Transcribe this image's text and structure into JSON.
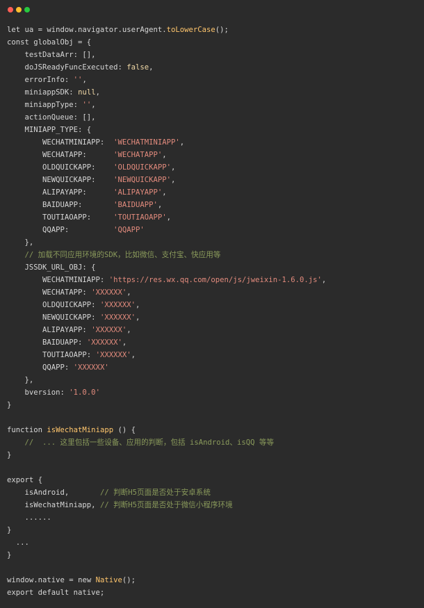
{
  "window": {
    "controls": {
      "close_color": "#ff5f56",
      "minimize_color": "#ffbd2e",
      "zoom_color": "#27c93f"
    },
    "background": "#2b2b2b"
  },
  "code": {
    "language": "javascript",
    "lines": [
      [
        {
          "t": "let ua = window.navigator.userAgent.",
          "c": "plain"
        },
        {
          "t": "toLowerCase",
          "c": "fn"
        },
        {
          "t": "();",
          "c": "plain"
        }
      ],
      [
        {
          "t": "const globalObj = {",
          "c": "plain"
        }
      ],
      [
        {
          "t": "    testDataArr: [],",
          "c": "plain"
        }
      ],
      [
        {
          "t": "    doJSReadyFuncExecuted: ",
          "c": "plain"
        },
        {
          "t": "false",
          "c": "lit"
        },
        {
          "t": ",",
          "c": "plain"
        }
      ],
      [
        {
          "t": "    errorInfo: ",
          "c": "plain"
        },
        {
          "t": "''",
          "c": "str"
        },
        {
          "t": ",",
          "c": "plain"
        }
      ],
      [
        {
          "t": "    miniappSDK: ",
          "c": "plain"
        },
        {
          "t": "null",
          "c": "lit"
        },
        {
          "t": ",",
          "c": "plain"
        }
      ],
      [
        {
          "t": "    miniappType: ",
          "c": "plain"
        },
        {
          "t": "''",
          "c": "str"
        },
        {
          "t": ",",
          "c": "plain"
        }
      ],
      [
        {
          "t": "    actionQueue: [],",
          "c": "plain"
        }
      ],
      [
        {
          "t": "    MINIAPP_TYPE: {",
          "c": "plain"
        }
      ],
      [
        {
          "t": "        WECHATMINIAPP:  ",
          "c": "plain"
        },
        {
          "t": "'WECHATMINIAPP'",
          "c": "str"
        },
        {
          "t": ",",
          "c": "plain"
        }
      ],
      [
        {
          "t": "        WECHATAPP:      ",
          "c": "plain"
        },
        {
          "t": "'WECHATAPP'",
          "c": "str"
        },
        {
          "t": ",",
          "c": "plain"
        }
      ],
      [
        {
          "t": "        OLDQUICKAPP:    ",
          "c": "plain"
        },
        {
          "t": "'OLDQUICKAPP'",
          "c": "str"
        },
        {
          "t": ",",
          "c": "plain"
        }
      ],
      [
        {
          "t": "        NEWQUICKAPP:    ",
          "c": "plain"
        },
        {
          "t": "'NEWQUICKAPP'",
          "c": "str"
        },
        {
          "t": ",",
          "c": "plain"
        }
      ],
      [
        {
          "t": "        ALIPAYAPP:      ",
          "c": "plain"
        },
        {
          "t": "'ALIPAYAPP'",
          "c": "str"
        },
        {
          "t": ",",
          "c": "plain"
        }
      ],
      [
        {
          "t": "        BAIDUAPP:       ",
          "c": "plain"
        },
        {
          "t": "'BAIDUAPP'",
          "c": "str"
        },
        {
          "t": ",",
          "c": "plain"
        }
      ],
      [
        {
          "t": "        TOUTIAOAPP:     ",
          "c": "plain"
        },
        {
          "t": "'TOUTIAOAPP'",
          "c": "str"
        },
        {
          "t": ",",
          "c": "plain"
        }
      ],
      [
        {
          "t": "        QQAPP:          ",
          "c": "plain"
        },
        {
          "t": "'QQAPP'",
          "c": "str"
        }
      ],
      [
        {
          "t": "    },",
          "c": "plain"
        }
      ],
      [
        {
          "t": "    // 加载不同应用环境的SDK，比如微信、支付宝、快应用等",
          "c": "com"
        }
      ],
      [
        {
          "t": "    JSSDK_URL_OBJ: {",
          "c": "plain"
        }
      ],
      [
        {
          "t": "        WECHATMINIAPP: ",
          "c": "plain"
        },
        {
          "t": "'https://res.wx.qq.com/open/js/jweixin-1.6.0.js'",
          "c": "str"
        },
        {
          "t": ",",
          "c": "plain"
        }
      ],
      [
        {
          "t": "        WECHATAPP: ",
          "c": "plain"
        },
        {
          "t": "'XXXXXX'",
          "c": "str"
        },
        {
          "t": ",",
          "c": "plain"
        }
      ],
      [
        {
          "t": "        OLDQUICKAPP: ",
          "c": "plain"
        },
        {
          "t": "'XXXXXX'",
          "c": "str"
        },
        {
          "t": ",",
          "c": "plain"
        }
      ],
      [
        {
          "t": "        NEWQUICKAPP: ",
          "c": "plain"
        },
        {
          "t": "'XXXXXX'",
          "c": "str"
        },
        {
          "t": ",",
          "c": "plain"
        }
      ],
      [
        {
          "t": "        ALIPAYAPP: ",
          "c": "plain"
        },
        {
          "t": "'XXXXXX'",
          "c": "str"
        },
        {
          "t": ",",
          "c": "plain"
        }
      ],
      [
        {
          "t": "        BAIDUAPP: ",
          "c": "plain"
        },
        {
          "t": "'XXXXXX'",
          "c": "str"
        },
        {
          "t": ",",
          "c": "plain"
        }
      ],
      [
        {
          "t": "        TOUTIAOAPP: ",
          "c": "plain"
        },
        {
          "t": "'XXXXXX'",
          "c": "str"
        },
        {
          "t": ",",
          "c": "plain"
        }
      ],
      [
        {
          "t": "        QQAPP: ",
          "c": "plain"
        },
        {
          "t": "'XXXXXX'",
          "c": "str"
        }
      ],
      [
        {
          "t": "    },",
          "c": "plain"
        }
      ],
      [
        {
          "t": "    bversion: ",
          "c": "plain"
        },
        {
          "t": "'1.0.0'",
          "c": "str"
        }
      ],
      [
        {
          "t": "}",
          "c": "plain"
        }
      ],
      [],
      [
        {
          "t": "function ",
          "c": "plain"
        },
        {
          "t": "isWechatMiniapp",
          "c": "fn"
        },
        {
          "t": " () {",
          "c": "plain"
        }
      ],
      [
        {
          "t": "    //  ... 这里包括一些设备、应用的判断，包括 isAndroid、isQQ 等等",
          "c": "com"
        }
      ],
      [
        {
          "t": "}",
          "c": "plain"
        }
      ],
      [],
      [
        {
          "t": "export {",
          "c": "plain"
        }
      ],
      [
        {
          "t": "    isAndroid,       ",
          "c": "plain"
        },
        {
          "t": "// 判断H5页面是否处于安卓系统",
          "c": "com"
        }
      ],
      [
        {
          "t": "    isWechatMiniapp, ",
          "c": "plain"
        },
        {
          "t": "// 判断H5页面是否处于微信小程序环境",
          "c": "com"
        }
      ],
      [
        {
          "t": "    ......",
          "c": "plain"
        }
      ],
      [
        {
          "t": "}",
          "c": "plain"
        }
      ],
      [
        {
          "t": "  ...",
          "c": "plain"
        }
      ],
      [
        {
          "t": "}",
          "c": "plain"
        }
      ],
      [],
      [
        {
          "t": "window.native = ",
          "c": "plain"
        },
        {
          "t": "new",
          "c": "plain"
        },
        {
          "t": " ",
          "c": "plain"
        },
        {
          "t": "Native",
          "c": "fn"
        },
        {
          "t": "();",
          "c": "plain"
        }
      ],
      [
        {
          "t": "export default native;",
          "c": "plain"
        }
      ]
    ]
  }
}
